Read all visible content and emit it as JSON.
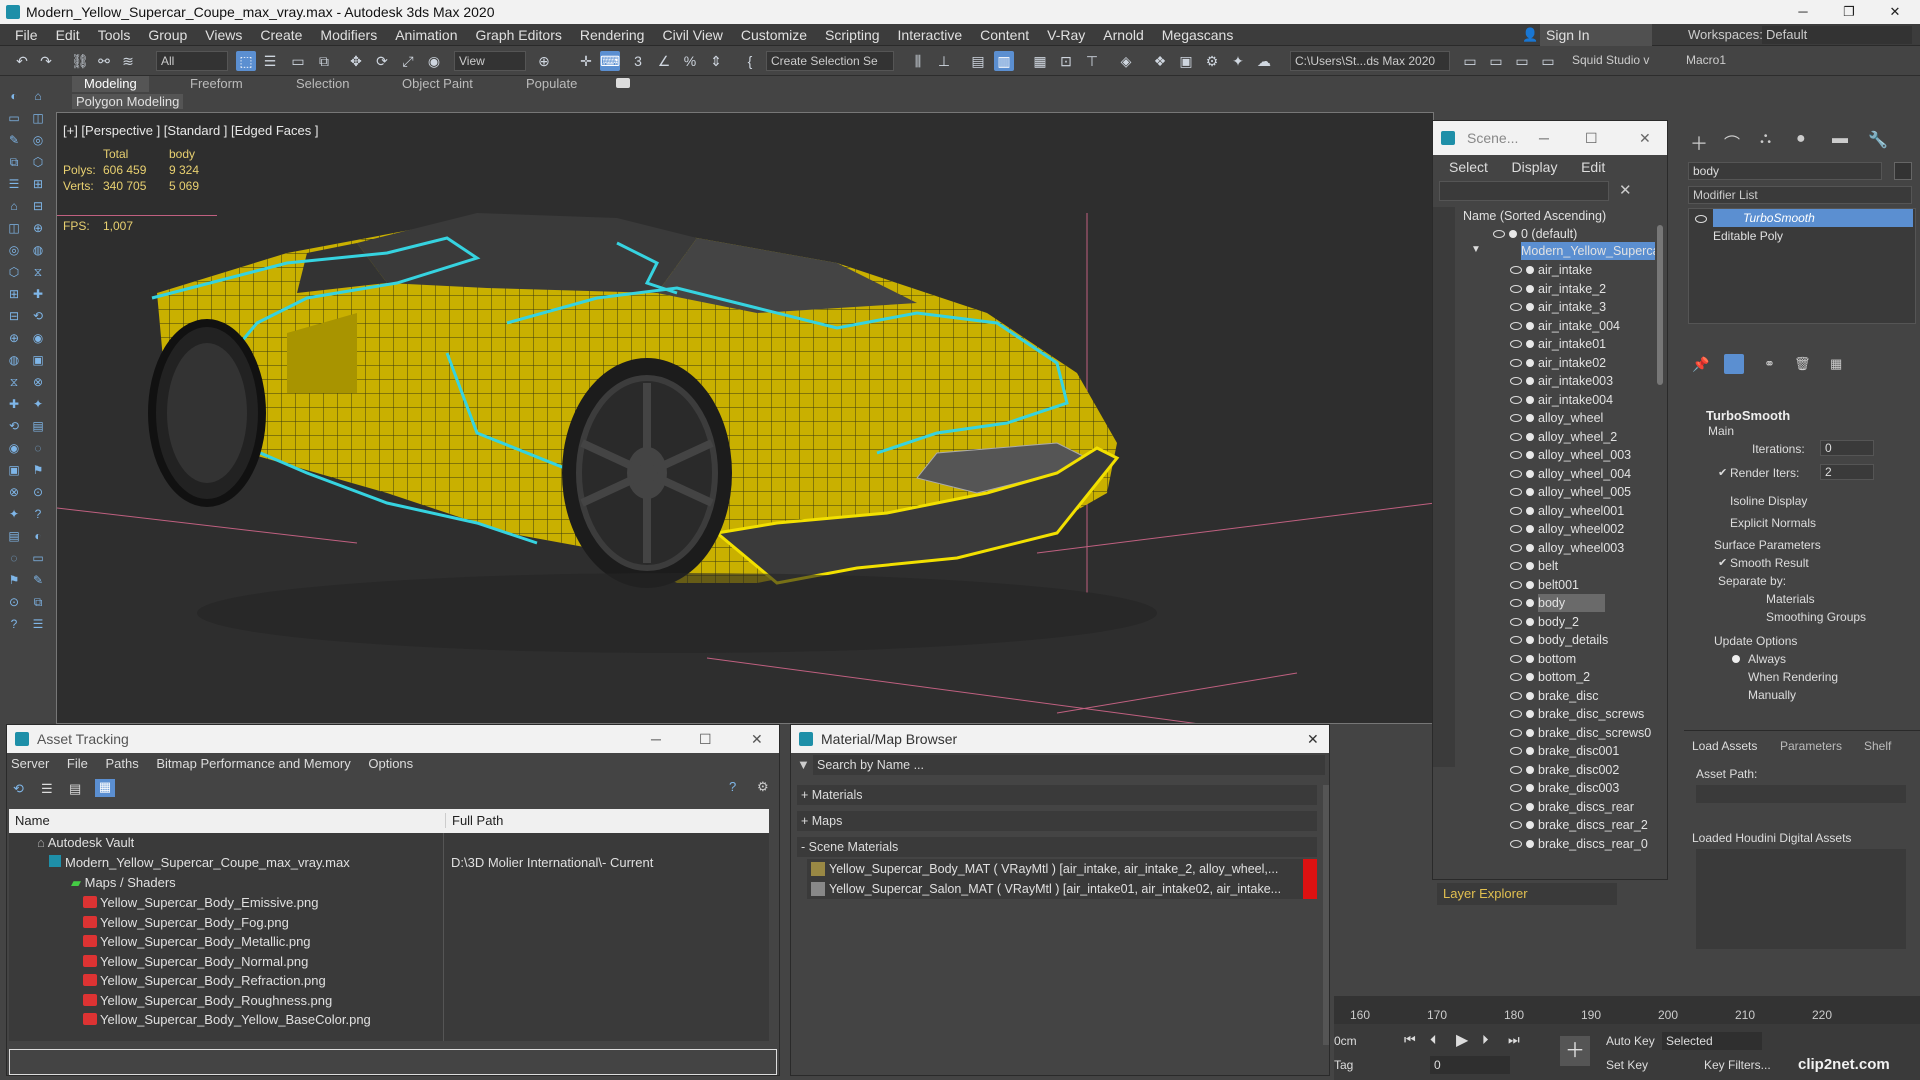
{
  "window": {
    "title": "Modern_Yellow_Supercar_Coupe_max_vray.max - Autodesk 3ds Max 2020"
  },
  "menu": [
    "File",
    "Edit",
    "Tools",
    "Group",
    "Views",
    "Create",
    "Modifiers",
    "Animation",
    "Graph Editors",
    "Rendering",
    "Civil View",
    "Customize",
    "Scripting",
    "Interactive",
    "Content",
    "V-Ray",
    "Arnold",
    "Megascans"
  ],
  "signin": "Sign In",
  "workspaces_label": "Workspaces:",
  "workspace_value": "Default",
  "toolbar": {
    "filter": "All",
    "refcoord": "View",
    "selset": "Create Selection Se",
    "path": "C:\\Users\\St...ds Max 2020",
    "studio": "Squid Studio v",
    "macro": "Macro1"
  },
  "ribbon": {
    "tabs": [
      "Modeling",
      "Freeform",
      "Selection",
      "Object Paint",
      "Populate"
    ],
    "sub": "Polygon Modeling"
  },
  "viewport": {
    "label": "[+] [Perspective ] [Standard ] [Edged Faces ]",
    "stats_total": "Total",
    "stats_body": "body",
    "polys_label": "Polys:",
    "polys_total": "606 459",
    "polys_body": "9 324",
    "verts_label": "Verts:",
    "verts_total": "340 705",
    "verts_body": "5 069",
    "fps_label": "FPS:",
    "fps_value": "1,007"
  },
  "scene": {
    "title": "Scene...",
    "menu": [
      "Select",
      "Display",
      "Edit"
    ],
    "col": "Name (Sorted Ascending)",
    "root": "0 (default)",
    "group": "Modern_Yellow_Supercar",
    "items": [
      "air_intake",
      "air_intake_2",
      "air_intake_3",
      "air_intake_004",
      "air_intake01",
      "air_intake02",
      "air_intake003",
      "air_intake004",
      "alloy_wheel",
      "alloy_wheel_2",
      "alloy_wheel_003",
      "alloy_wheel_004",
      "alloy_wheel_005",
      "alloy_wheel001",
      "alloy_wheel002",
      "alloy_wheel003",
      "belt",
      "belt001",
      "body",
      "body_2",
      "body_details",
      "bottom",
      "bottom_2",
      "brake_disc",
      "brake_disc_screws",
      "brake_disc_screws0",
      "brake_disc001",
      "brake_disc002",
      "brake_disc003",
      "brake_discs_rear",
      "brake_discs_rear_2",
      "brake_discs_rear_0"
    ],
    "footer": "Layer Explorer"
  },
  "modify": {
    "name": "body",
    "list": "Modifier List",
    "stack": [
      "TurboSmooth",
      "Editable Poly"
    ],
    "rollout": "TurboSmooth",
    "main": "Main",
    "iterations_label": "Iterations:",
    "iterations": "0",
    "render_iters_label": "Render Iters:",
    "render_iters": "2",
    "isoline": "Isoline Display",
    "explicit": "Explicit Normals",
    "surface": "Surface Parameters",
    "smooth": "Smooth Result",
    "separate": "Separate by:",
    "materials": "Materials",
    "smoothing": "Smoothing Groups",
    "update": "Update Options",
    "always": "Always",
    "when_render": "When Rendering",
    "manually": "Manually"
  },
  "houdini": {
    "tabs": [
      "Load Assets",
      "Parameters",
      "Shelf"
    ],
    "asset_path": "Asset Path:",
    "loaded": "Loaded Houdini Digital Assets"
  },
  "asset": {
    "title": "Asset Tracking",
    "menu": [
      "Server",
      "File",
      "Paths",
      "Bitmap Performance and Memory",
      "Options"
    ],
    "col_name": "Name",
    "col_path": "Full Path",
    "vault": "Autodesk Vault",
    "file": "Modern_Yellow_Supercar_Coupe_max_vray.max",
    "file_path": "D:\\3D Molier International\\- Current",
    "maps": "Maps / Shaders",
    "files": [
      "Yellow_Supercar_Body_Emissive.png",
      "Yellow_Supercar_Body_Fog.png",
      "Yellow_Supercar_Body_Metallic.png",
      "Yellow_Supercar_Body_Normal.png",
      "Yellow_Supercar_Body_Refraction.png",
      "Yellow_Supercar_Body_Roughness.png",
      "Yellow_Supercar_Body_Yellow_BaseColor.png"
    ]
  },
  "matb": {
    "title": "Material/Map Browser",
    "search": "Search by Name ...",
    "sections": [
      "+ Materials",
      "+ Maps",
      "- Scene Materials"
    ],
    "mats": [
      "Yellow_Supercar_Body_MAT ( VRayMtl ) [air_intake, air_intake_2, alloy_wheel,...",
      "Yellow_Supercar_Salon_MAT ( VRayMtl ) [air_intake01, air_intake02, air_intake..."
    ]
  },
  "timeline": {
    "ticks": [
      "160",
      "170",
      "180",
      "190",
      "200",
      "210",
      "220"
    ],
    "cm": "0cm",
    "frame": "0",
    "autokey": "Auto Key",
    "selected": "Selected",
    "setkey": "Set Key",
    "keyfilters": "Key Filters...",
    "tag": "Tag"
  },
  "watermark": "clip2net.com"
}
